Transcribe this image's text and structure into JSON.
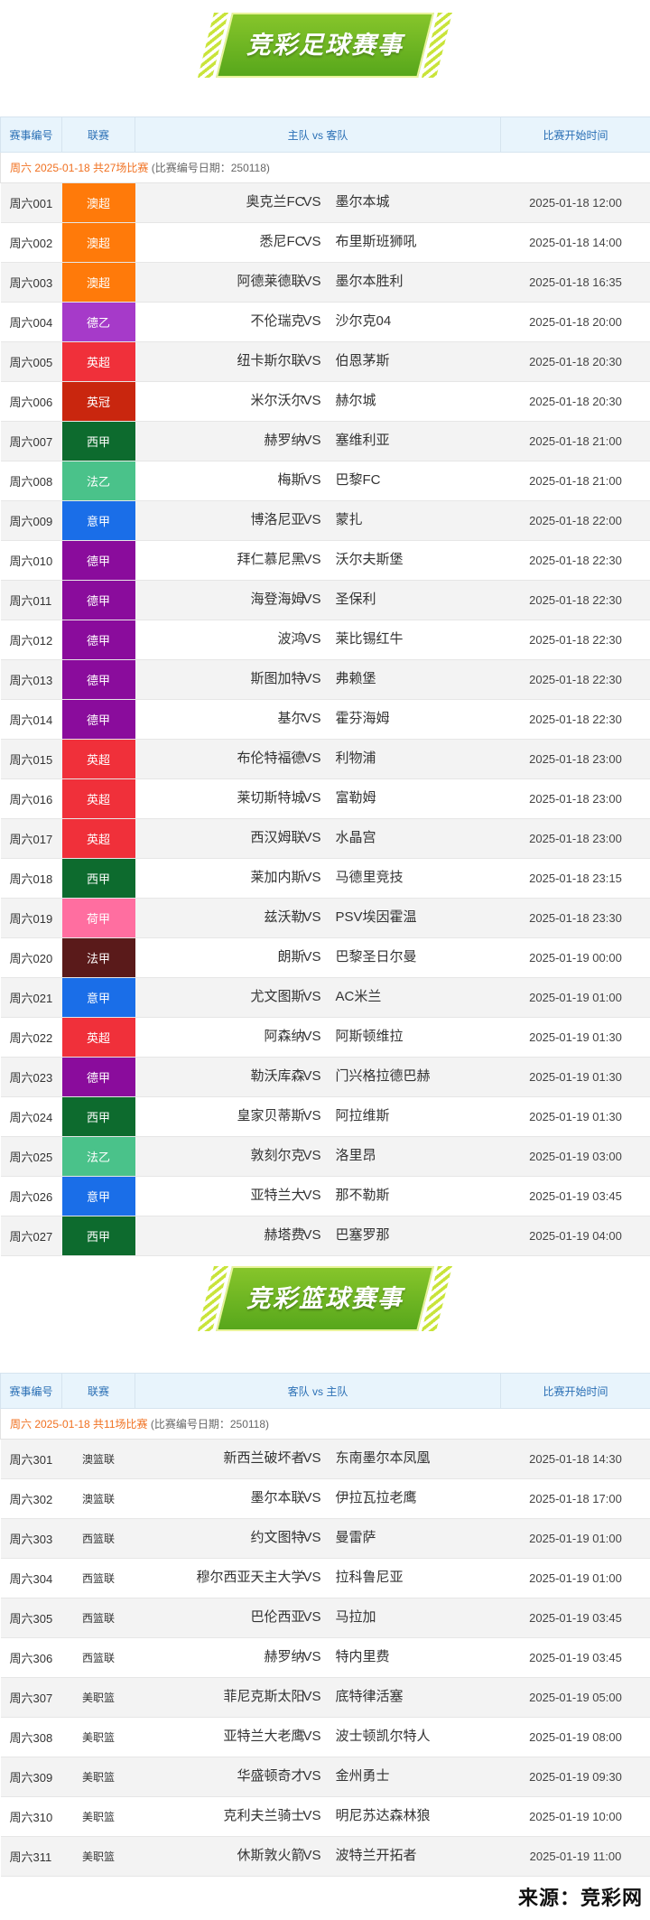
{
  "football": {
    "title": "竞彩足球赛事",
    "headers": {
      "num": "赛事编号",
      "league": "联赛",
      "teams": "主队 vs 客队",
      "time": "比赛开始时间"
    },
    "info": {
      "date_text": "周六 2025-01-18 共27场比赛",
      "note": "(比赛编号日期：250118)"
    },
    "vs": "VS",
    "rows": [
      {
        "num": "周六001",
        "league": "澳超",
        "color": "#ff7a0a",
        "home": "奥克兰FC",
        "away": "墨尔本城",
        "time": "2025-01-18 12:00"
      },
      {
        "num": "周六002",
        "league": "澳超",
        "color": "#ff7a0a",
        "home": "悉尼FC",
        "away": "布里斯班狮吼",
        "time": "2025-01-18 14:00"
      },
      {
        "num": "周六003",
        "league": "澳超",
        "color": "#ff7a0a",
        "home": "阿德莱德联",
        "away": "墨尔本胜利",
        "time": "2025-01-18 16:35"
      },
      {
        "num": "周六004",
        "league": "德乙",
        "color": "#a63ac9",
        "home": "不伦瑞克",
        "away": "沙尔克04",
        "time": "2025-01-18 20:00"
      },
      {
        "num": "周六005",
        "league": "英超",
        "color": "#f0303a",
        "home": "纽卡斯尔联",
        "away": "伯恩茅斯",
        "time": "2025-01-18 20:30"
      },
      {
        "num": "周六006",
        "league": "英冠",
        "color": "#c9260e",
        "home": "米尔沃尔",
        "away": "赫尔城",
        "time": "2025-01-18 20:30"
      },
      {
        "num": "周六007",
        "league": "西甲",
        "color": "#0d6b2e",
        "home": "赫罗纳",
        "away": "塞维利亚",
        "time": "2025-01-18 21:00"
      },
      {
        "num": "周六008",
        "league": "法乙",
        "color": "#4ac28a",
        "home": "梅斯",
        "away": "巴黎FC",
        "time": "2025-01-18 21:00"
      },
      {
        "num": "周六009",
        "league": "意甲",
        "color": "#1a6ee8",
        "home": "博洛尼亚",
        "away": "蒙扎",
        "time": "2025-01-18 22:00"
      },
      {
        "num": "周六010",
        "league": "德甲",
        "color": "#8a0c9c",
        "home": "拜仁慕尼黑",
        "away": "沃尔夫斯堡",
        "time": "2025-01-18 22:30"
      },
      {
        "num": "周六011",
        "league": "德甲",
        "color": "#8a0c9c",
        "home": "海登海姆",
        "away": "圣保利",
        "time": "2025-01-18 22:30"
      },
      {
        "num": "周六012",
        "league": "德甲",
        "color": "#8a0c9c",
        "home": "波鸿",
        "away": "莱比锡红牛",
        "time": "2025-01-18 22:30"
      },
      {
        "num": "周六013",
        "league": "德甲",
        "color": "#8a0c9c",
        "home": "斯图加特",
        "away": "弗赖堡",
        "time": "2025-01-18 22:30"
      },
      {
        "num": "周六014",
        "league": "德甲",
        "color": "#8a0c9c",
        "home": "基尔",
        "away": "霍芬海姆",
        "time": "2025-01-18 22:30"
      },
      {
        "num": "周六015",
        "league": "英超",
        "color": "#f0303a",
        "home": "布伦特福德",
        "away": "利物浦",
        "time": "2025-01-18 23:00"
      },
      {
        "num": "周六016",
        "league": "英超",
        "color": "#f0303a",
        "home": "莱切斯特城",
        "away": "富勒姆",
        "time": "2025-01-18 23:00"
      },
      {
        "num": "周六017",
        "league": "英超",
        "color": "#f0303a",
        "home": "西汉姆联",
        "away": "水晶宫",
        "time": "2025-01-18 23:00"
      },
      {
        "num": "周六018",
        "league": "西甲",
        "color": "#0d6b2e",
        "home": "莱加内斯",
        "away": "马德里竞技",
        "time": "2025-01-18 23:15"
      },
      {
        "num": "周六019",
        "league": "荷甲",
        "color": "#ff6ea0",
        "home": "兹沃勒",
        "away": "PSV埃因霍温",
        "time": "2025-01-18 23:30"
      },
      {
        "num": "周六020",
        "league": "法甲",
        "color": "#5a1a1a",
        "home": "朗斯",
        "away": "巴黎圣日尔曼",
        "time": "2025-01-19 00:00"
      },
      {
        "num": "周六021",
        "league": "意甲",
        "color": "#1a6ee8",
        "home": "尤文图斯",
        "away": "AC米兰",
        "time": "2025-01-19 01:00"
      },
      {
        "num": "周六022",
        "league": "英超",
        "color": "#f0303a",
        "home": "阿森纳",
        "away": "阿斯顿维拉",
        "time": "2025-01-19 01:30"
      },
      {
        "num": "周六023",
        "league": "德甲",
        "color": "#8a0c9c",
        "home": "勒沃库森",
        "away": "门兴格拉德巴赫",
        "time": "2025-01-19 01:30"
      },
      {
        "num": "周六024",
        "league": "西甲",
        "color": "#0d6b2e",
        "home": "皇家贝蒂斯",
        "away": "阿拉维斯",
        "time": "2025-01-19 01:30"
      },
      {
        "num": "周六025",
        "league": "法乙",
        "color": "#4ac28a",
        "home": "敦刻尔克",
        "away": "洛里昂",
        "time": "2025-01-19 03:00"
      },
      {
        "num": "周六026",
        "league": "意甲",
        "color": "#1a6ee8",
        "home": "亚特兰大",
        "away": "那不勒斯",
        "time": "2025-01-19 03:45"
      },
      {
        "num": "周六027",
        "league": "西甲",
        "color": "#0d6b2e",
        "home": "赫塔费",
        "away": "巴塞罗那",
        "time": "2025-01-19 04:00"
      }
    ]
  },
  "basketball": {
    "title": "竞彩篮球赛事",
    "headers": {
      "num": "赛事编号",
      "league": "联赛",
      "teams": "客队 vs 主队",
      "time": "比赛开始时间"
    },
    "info": {
      "date_text": "周六 2025-01-18 共11场比赛",
      "note": "(比赛编号日期：250118)"
    },
    "vs": "VS",
    "rows": [
      {
        "num": "周六301",
        "league": "澳篮联",
        "home": "新西兰破坏者",
        "away": "东南墨尔本凤凰",
        "time": "2025-01-18 14:30"
      },
      {
        "num": "周六302",
        "league": "澳篮联",
        "home": "墨尔本联",
        "away": "伊拉瓦拉老鹰",
        "time": "2025-01-18 17:00"
      },
      {
        "num": "周六303",
        "league": "西篮联",
        "home": "约文图特",
        "away": "曼雷萨",
        "time": "2025-01-19 01:00"
      },
      {
        "num": "周六304",
        "league": "西篮联",
        "home": "穆尔西亚天主大学",
        "away": "拉科鲁尼亚",
        "time": "2025-01-19 01:00"
      },
      {
        "num": "周六305",
        "league": "西篮联",
        "home": "巴伦西亚",
        "away": "马拉加",
        "time": "2025-01-19 03:45"
      },
      {
        "num": "周六306",
        "league": "西篮联",
        "home": "赫罗纳",
        "away": "特内里费",
        "time": "2025-01-19 03:45"
      },
      {
        "num": "周六307",
        "league": "美职篮",
        "home": "菲尼克斯太阳",
        "away": "底特律活塞",
        "time": "2025-01-19 05:00"
      },
      {
        "num": "周六308",
        "league": "美职篮",
        "home": "亚特兰大老鹰",
        "away": "波士顿凯尔特人",
        "time": "2025-01-19 08:00"
      },
      {
        "num": "周六309",
        "league": "美职篮",
        "home": "华盛顿奇才",
        "away": "金州勇士",
        "time": "2025-01-19 09:30"
      },
      {
        "num": "周六310",
        "league": "美职篮",
        "home": "克利夫兰骑士",
        "away": "明尼苏达森林狼",
        "time": "2025-01-19 10:00"
      },
      {
        "num": "周六311",
        "league": "美职篮",
        "home": "休斯敦火箭",
        "away": "波特兰开拓者",
        "time": "2025-01-19 11:00"
      }
    ]
  },
  "source": "来源：竞彩网"
}
